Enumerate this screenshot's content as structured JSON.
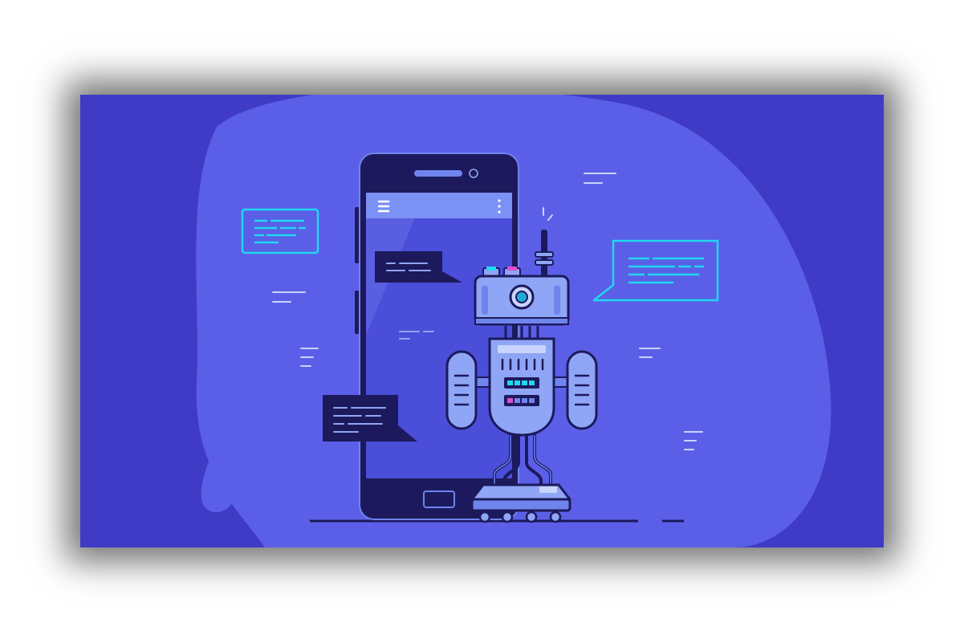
{
  "illustration": {
    "subject": "chatbot-robot-with-smartphone",
    "colors": {
      "background": "#3f3bc6",
      "blob": "#5b5fe8",
      "phone_body": "#1c1a5c",
      "phone_screen": "#4b4ed8",
      "phone_header": "#7c91f5",
      "robot_light": "#8fa5f5",
      "robot_mid": "#6f84ec",
      "robot_dark": "#1c1a5c",
      "accent_cyan": "#21d8f0",
      "accent_pink": "#e04fd0",
      "chat_dark": "#1c1a5c",
      "line_light": "#c9d4ff"
    }
  }
}
